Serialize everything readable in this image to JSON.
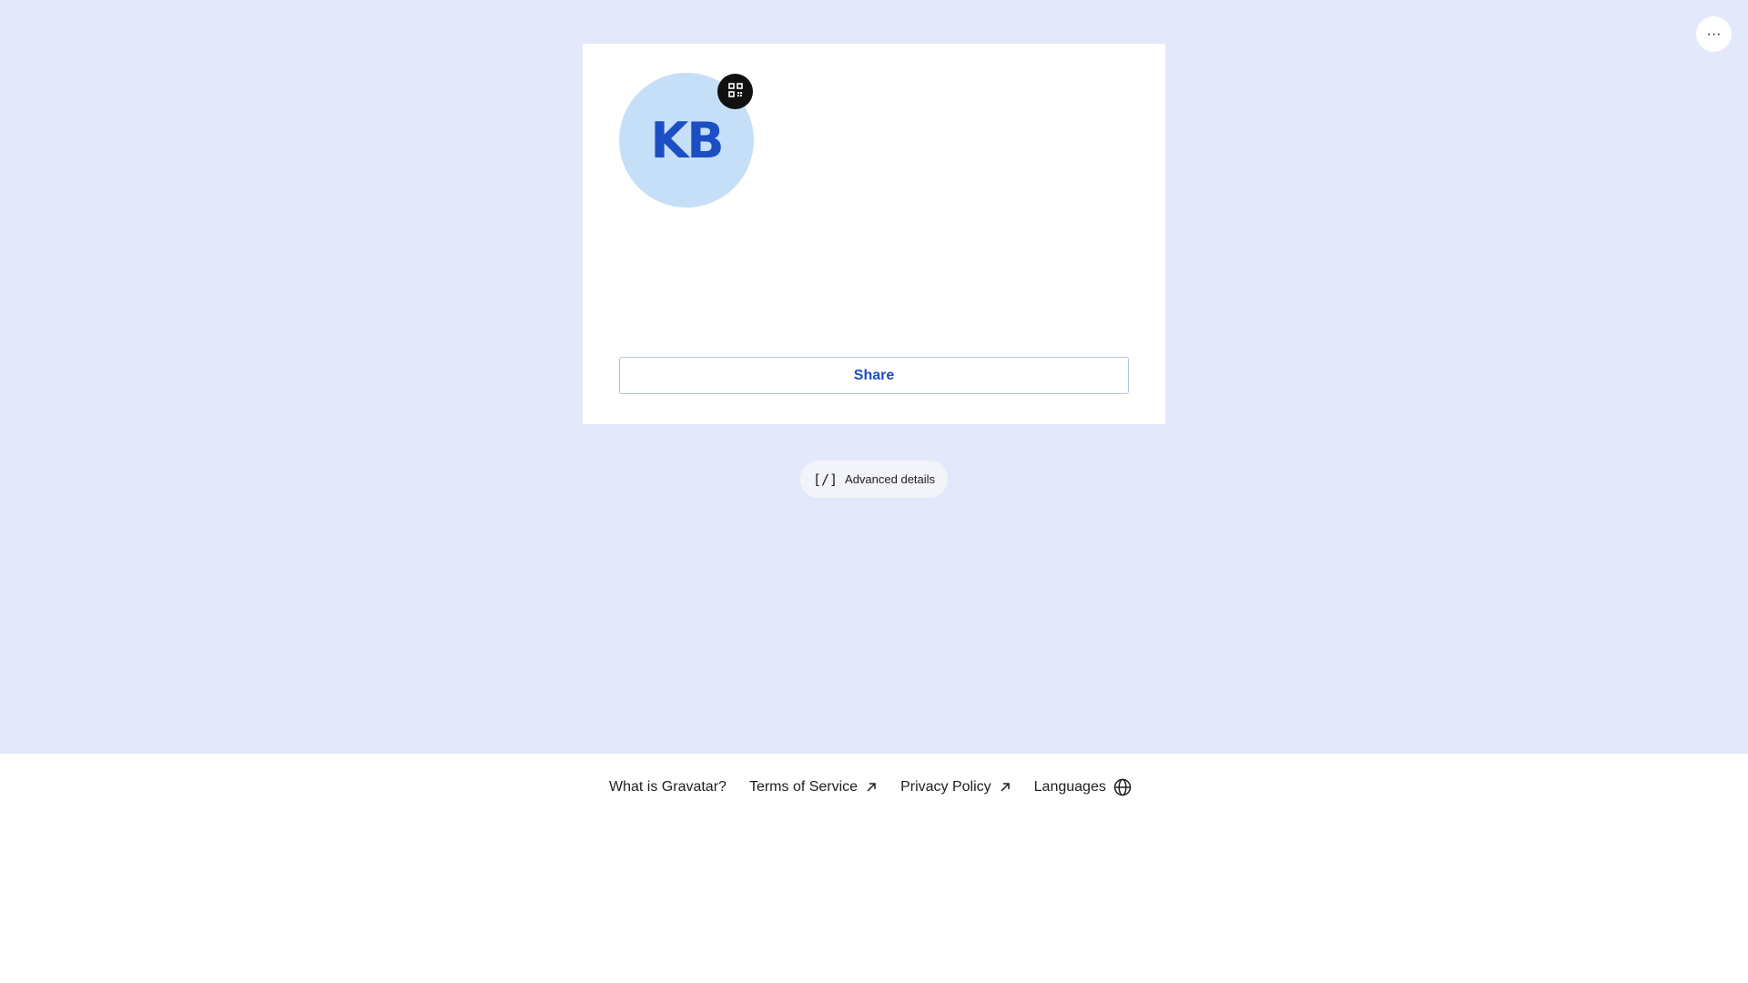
{
  "header": {
    "more_button_label": "···"
  },
  "profile_card": {
    "avatar_initials": "KB",
    "share_label": "Share"
  },
  "advanced": {
    "icon_glyph": "[/]",
    "label": "Advanced details"
  },
  "footer": {
    "links": [
      {
        "label": "What is Gravatar?",
        "icon": ""
      },
      {
        "label": "Terms of Service",
        "icon": "external-arrow-icon"
      },
      {
        "label": "Privacy Policy",
        "icon": "external-arrow-icon"
      },
      {
        "label": "Languages",
        "icon": "globe-icon"
      }
    ]
  },
  "colors": {
    "page_background": "#e3e9fa",
    "avatar_background": "#c5dff8",
    "accent": "#1c4ec4"
  }
}
